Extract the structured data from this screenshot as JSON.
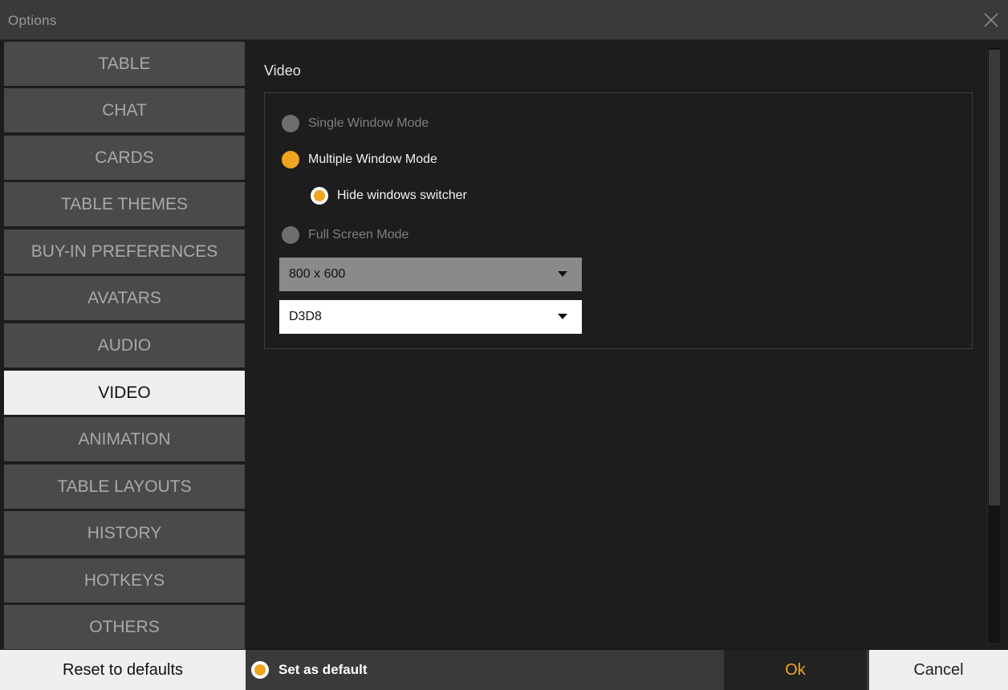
{
  "window": {
    "title": "Options",
    "close_icon": "close-icon"
  },
  "sidebar": {
    "items": [
      {
        "label": "TABLE"
      },
      {
        "label": "CHAT"
      },
      {
        "label": "CARDS"
      },
      {
        "label": "TABLE THEMES"
      },
      {
        "label": "BUY-IN PREFERENCES"
      },
      {
        "label": "AVATARS"
      },
      {
        "label": "AUDIO"
      },
      {
        "label": "VIDEO",
        "selected": true
      },
      {
        "label": "ANIMATION"
      },
      {
        "label": "TABLE LAYOUTS"
      },
      {
        "label": "HISTORY"
      },
      {
        "label": "HOTKEYS"
      },
      {
        "label": "OTHERS"
      }
    ]
  },
  "content": {
    "section_title": "Video",
    "options": {
      "single_window": {
        "label": "Single Window Mode",
        "selected": false,
        "enabled": false
      },
      "multiple_window": {
        "label": "Multiple Window Mode",
        "selected": true,
        "enabled": true
      },
      "hide_switcher": {
        "label": "Hide windows switcher",
        "selected": true,
        "enabled": true
      },
      "full_screen": {
        "label": "Full Screen Mode",
        "selected": false,
        "enabled": false
      }
    },
    "resolution_dropdown": {
      "value": "800 x 600"
    },
    "renderer_dropdown": {
      "value": "D3D8"
    }
  },
  "footer": {
    "reset_label": "Reset to defaults",
    "set_default_label": "Set as default",
    "ok_label": "Ok",
    "cancel_label": "Cancel"
  },
  "colors": {
    "accent": "#f0a51e",
    "nav_bg": "#4a4a4a",
    "nav_selected_bg": "#efefef",
    "panel_bg": "#1d1d1d",
    "titlebar_bg": "#3a3a3a"
  }
}
